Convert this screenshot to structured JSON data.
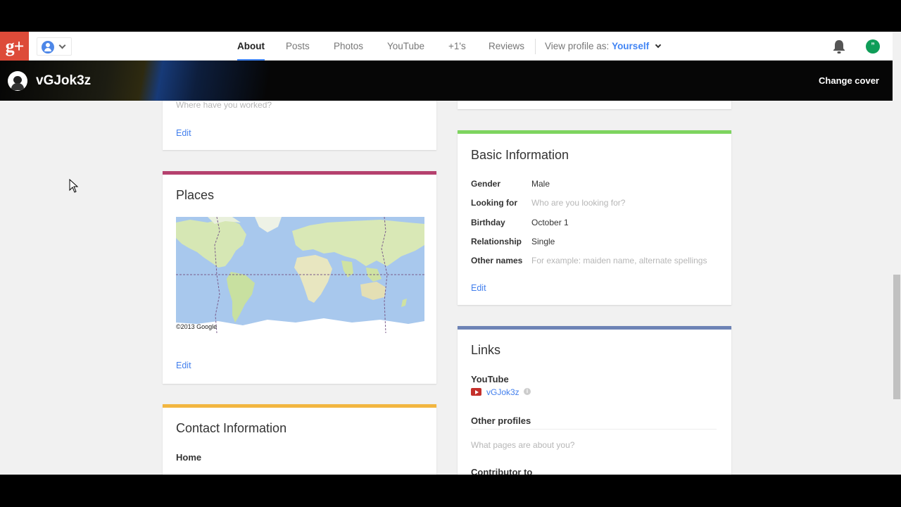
{
  "nav": {
    "logo": "g+",
    "tabs": [
      "About",
      "Posts",
      "Photos",
      "YouTube",
      "+1's",
      "Reviews"
    ],
    "view_as_label": "View profile as:",
    "view_as_value": "Yourself",
    "hangouts_glyph": "”"
  },
  "cover": {
    "name": "vGJok3z",
    "change_cover": "Change cover"
  },
  "work": {
    "placeholder": "Where have you worked?",
    "edit": "Edit"
  },
  "places": {
    "title": "Places",
    "map_credit": "©2013 Google",
    "edit": "Edit",
    "accent": "#b5416e"
  },
  "contact": {
    "title": "Contact Information",
    "home": "Home",
    "accent": "#f2b640"
  },
  "basic": {
    "title": "Basic Information",
    "accent": "#7ed45f",
    "rows": [
      {
        "label": "Gender",
        "value": "Male",
        "placeholder": false
      },
      {
        "label": "Looking for",
        "value": "Who are you looking for?",
        "placeholder": true
      },
      {
        "label": "Birthday",
        "value": "October 1",
        "placeholder": false
      },
      {
        "label": "Relationship",
        "value": "Single",
        "placeholder": false
      },
      {
        "label": "Other names",
        "value": "For example: maiden name, alternate spellings",
        "placeholder": true
      }
    ],
    "edit": "Edit"
  },
  "links": {
    "title": "Links",
    "accent": "#6d83b6",
    "youtube_label": "YouTube",
    "youtube_link": "vGJok3z",
    "other_profiles": "Other profiles",
    "other_placeholder": "What pages are about you?",
    "contributor": "Contributor to"
  }
}
